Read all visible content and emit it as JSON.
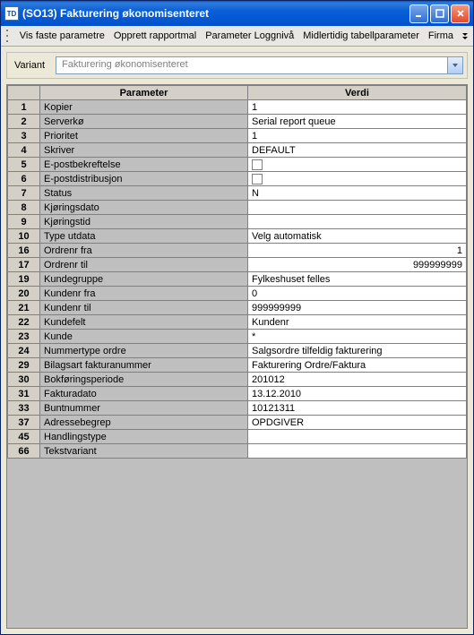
{
  "window": {
    "title": "(SO13) Fakturering økonomisenteret"
  },
  "menu": {
    "items": [
      "Vis faste parametre",
      "Opprett rapportmal",
      "Parameter Loggnivå",
      "Midlertidig tabellparameter",
      "Firma"
    ]
  },
  "variant": {
    "label": "Variant",
    "value": "Fakturering økonomisenteret"
  },
  "headers": {
    "parameter": "Parameter",
    "value": "Verdi"
  },
  "rows": [
    {
      "n": "1",
      "param": "Kopier",
      "value": "1",
      "type": "text"
    },
    {
      "n": "2",
      "param": "Serverkø",
      "value": "Serial report queue",
      "type": "text"
    },
    {
      "n": "3",
      "param": "Prioritet",
      "value": "1",
      "type": "text"
    },
    {
      "n": "4",
      "param": "Skriver",
      "value": "DEFAULT",
      "type": "text"
    },
    {
      "n": "5",
      "param": "E-postbekreftelse",
      "value": "",
      "type": "check"
    },
    {
      "n": "6",
      "param": "E-postdistribusjon",
      "value": "",
      "type": "check"
    },
    {
      "n": "7",
      "param": "Status",
      "value": "N",
      "type": "text"
    },
    {
      "n": "8",
      "param": "Kjøringsdato",
      "value": "",
      "type": "text"
    },
    {
      "n": "9",
      "param": "Kjøringstid",
      "value": "",
      "type": "text"
    },
    {
      "n": "10",
      "param": "Type utdata",
      "value": "Velg automatisk",
      "type": "text"
    },
    {
      "n": "16",
      "param": "Ordrenr fra",
      "value": "1",
      "type": "num"
    },
    {
      "n": "17",
      "param": "Ordrenr til",
      "value": "999999999",
      "type": "num"
    },
    {
      "n": "19",
      "param": "Kundegruppe",
      "value": "Fylkeshuset felles",
      "type": "text"
    },
    {
      "n": "20",
      "param": "Kundenr fra",
      "value": "0",
      "type": "text"
    },
    {
      "n": "21",
      "param": "Kundenr til",
      "value": "999999999",
      "type": "text"
    },
    {
      "n": "22",
      "param": "Kundefelt",
      "value": "Kundenr",
      "type": "text"
    },
    {
      "n": "23",
      "param": "Kunde",
      "value": "*",
      "type": "text"
    },
    {
      "n": "24",
      "param": "Nummertype ordre",
      "value": "Salgsordre tilfeldig fakturering",
      "type": "text"
    },
    {
      "n": "29",
      "param": "Bilagsart fakturanummer",
      "value": "Fakturering Ordre/Faktura",
      "type": "text"
    },
    {
      "n": "30",
      "param": "Bokføringsperiode",
      "value": "201012",
      "type": "text"
    },
    {
      "n": "31",
      "param": "Fakturadato",
      "value": "13.12.2010",
      "type": "text"
    },
    {
      "n": "33",
      "param": "Buntnummer",
      "value": "10121311",
      "type": "text"
    },
    {
      "n": "37",
      "param": "Adressebegrep",
      "value": "OPDGIVER",
      "type": "text"
    },
    {
      "n": "45",
      "param": "Handlingstype",
      "value": "",
      "type": "text"
    },
    {
      "n": "66",
      "param": "Tekstvariant",
      "value": "",
      "type": "text"
    }
  ]
}
